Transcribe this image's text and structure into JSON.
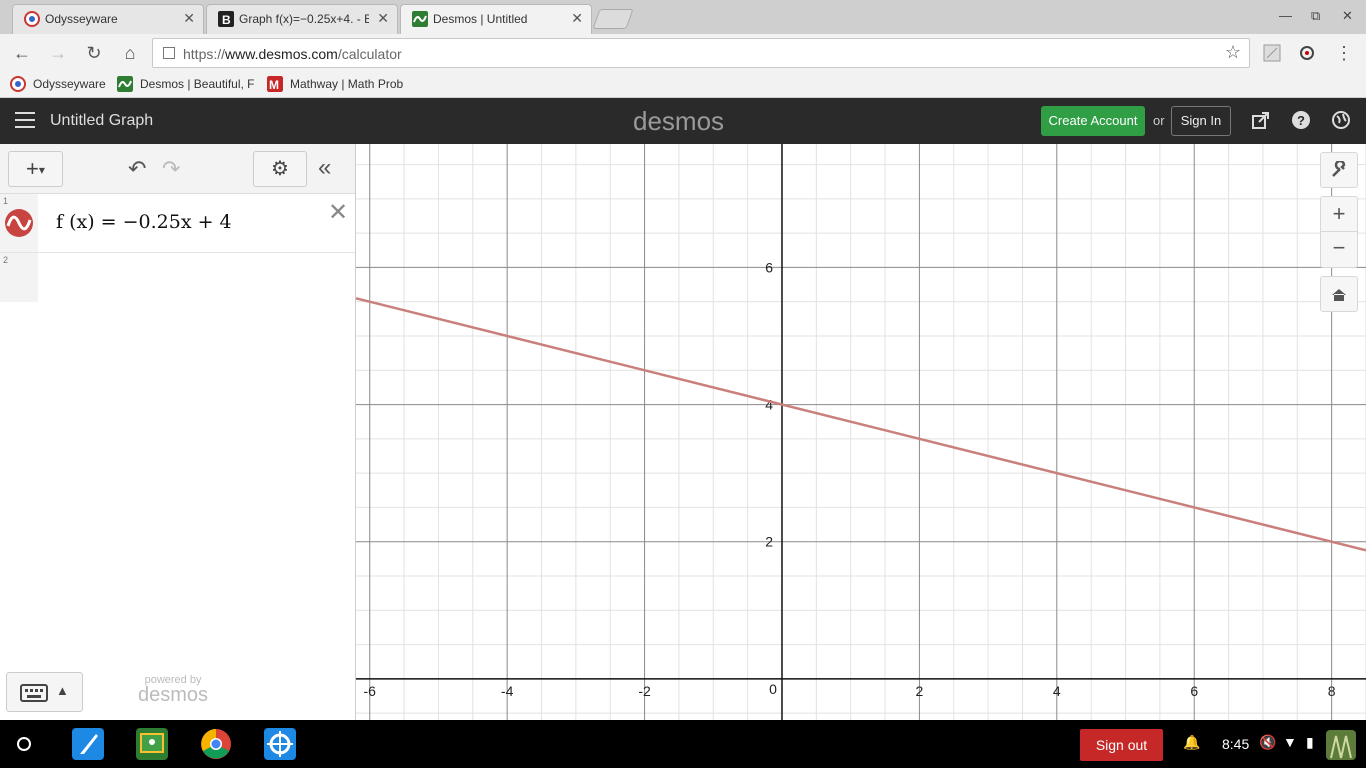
{
  "browser": {
    "tabs": [
      {
        "title": "Odysseyware",
        "active": false
      },
      {
        "title": "Graph f(x)=−0.25x+4. - B",
        "active": false
      },
      {
        "title": "Desmos | Untitled",
        "active": true
      }
    ],
    "url_prefix": "https://",
    "url_domain": "www.desmos.com",
    "url_path": "/calculator",
    "bookmarks": [
      "Odysseyware",
      "Desmos | Beautiful, F",
      "Mathway | Math Prob"
    ]
  },
  "header": {
    "graph_title": "Untitled Graph",
    "logo": "desmos",
    "create_account": "Create Account",
    "or": "or",
    "sign_in": "Sign In"
  },
  "panel": {
    "expressions": [
      {
        "index": "1",
        "latex": "f (x) = −0.25x + 4",
        "color": "#c74440"
      },
      {
        "index": "2",
        "latex": ""
      }
    ],
    "powered_by": "powered by",
    "powered_logo": "desmos"
  },
  "graph": {
    "x_ticks": [
      "-6",
      "-4",
      "-2",
      "0",
      "2",
      "4",
      "6",
      "8"
    ],
    "y_ticks": [
      "6",
      "4",
      "2"
    ],
    "line_color": "#c9807b",
    "grid": true
  },
  "chart_data": {
    "type": "line",
    "function": "f(x) = -0.25x + 4",
    "slope": -0.25,
    "intercept": 4,
    "xlim": [
      -6.2,
      8.5
    ],
    "ylim": [
      -0.6,
      7.8
    ],
    "x_ticks": [
      -6,
      -4,
      -2,
      0,
      2,
      4,
      6,
      8
    ],
    "y_ticks": [
      2,
      4,
      6
    ],
    "series": [
      {
        "x": [
          -6.2,
          8.5
        ],
        "y": [
          5.55,
          1.875
        ]
      }
    ]
  },
  "shelf": {
    "sign_out": "Sign out",
    "time": "8:45"
  }
}
